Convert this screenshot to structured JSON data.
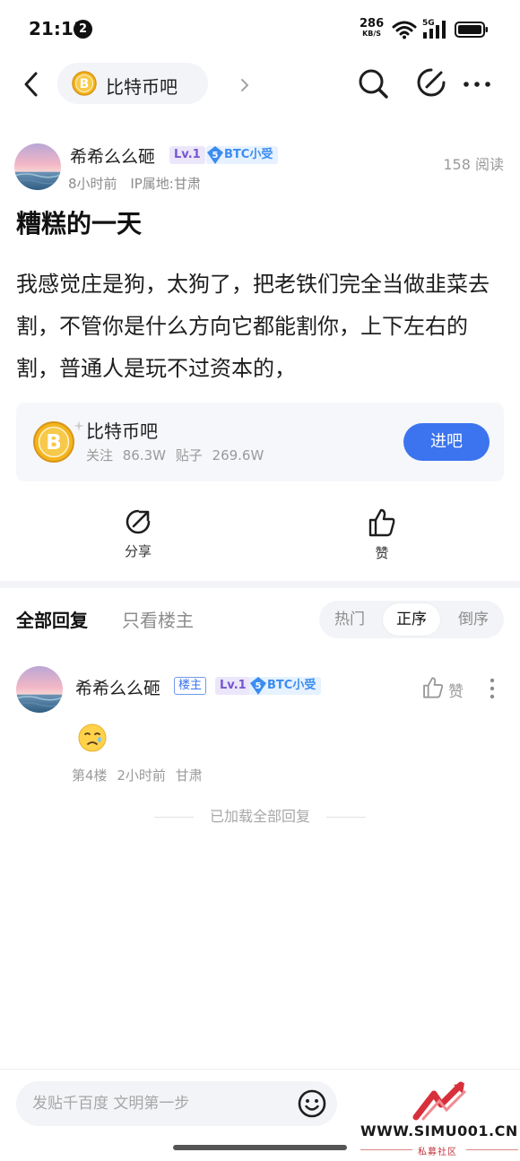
{
  "status_bar": {
    "time": "21:11",
    "notification_count": "2",
    "net_speed": "286",
    "net_speed_unit": "KB/S",
    "network": "5G"
  },
  "nav": {
    "forum_name": "比特币吧"
  },
  "post": {
    "author": "希希么么砸",
    "level": "Lv.1",
    "badge_level": "5",
    "badge_text": "BTC小受",
    "read_count": "158 阅读",
    "time": "8小时前",
    "ip_location": "IP属地:甘肃",
    "title": "糟糕的一天",
    "body": "我感觉庄是狗，太狗了，把老铁们完全当做韭菜去割，不管你是什么方向它都能割你，上下左右的割，普通人是玩不过资本的，"
  },
  "forum_card": {
    "name": "比特币吧",
    "stats": "关注 86.3W 贴子 269.6W",
    "enter_label": "进吧"
  },
  "actions": {
    "share_label": "分享",
    "like_label": "赞"
  },
  "reply_tabs": {
    "all_label": "全部回复",
    "op_only_label": "只看楼主",
    "sort_options": [
      "热门",
      "正序",
      "倒序"
    ],
    "active_sort": "正序"
  },
  "reply": {
    "author": "希希么么砸",
    "host_label": "楼主",
    "level": "Lv.1",
    "badge_level": "5",
    "badge_text": "BTC小受",
    "like_label": "赞",
    "emoji": "🥲",
    "floor": "第4楼",
    "time": "2小时前",
    "location": "甘肃"
  },
  "loaded_text": "已加载全部回复",
  "comment_box": {
    "placeholder": "发贴千百度 文明第一步"
  },
  "watermark": {
    "site": "WWW.SIMU001.CN",
    "label": "私募社区"
  },
  "colors": {
    "accent_blue": "#3b74ee",
    "level_purple": "#7557cf",
    "badge_blue": "#3b8cf0",
    "coin_gold": "#f3b51c"
  }
}
